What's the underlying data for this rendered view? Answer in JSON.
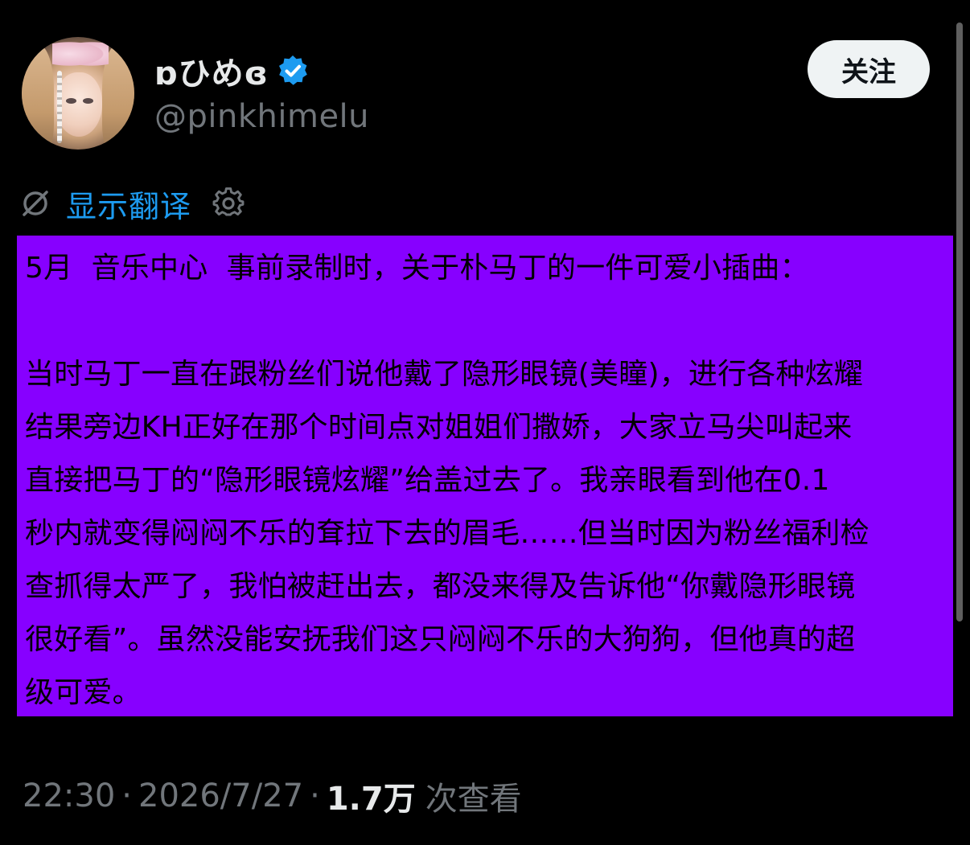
{
  "author": {
    "display_name": "ɒひめɞ",
    "handle": "@pinkhimelu",
    "verified": true,
    "verified_color": "#1d9bf0"
  },
  "actions": {
    "follow_label": "关注"
  },
  "translate": {
    "label": "显示翻译",
    "icons": [
      "translate-off-icon",
      "gear-icon"
    ]
  },
  "tweet": {
    "highlight_color": "#8700ff",
    "lines": [
      "5月  音乐中心  事前录制时，关于朴马丁的一件可爱小插曲：",
      "当时马丁一直在跟粉丝们说他戴了隐形眼镜(美瞳)，进行各种炫耀",
      "结果旁边KH正好在那个时间点对姐姐们撒娇，大家立马尖叫起来",
      "直接把马丁的“隐形眼镜炫耀”给盖过去了。我亲眼看到他在0.1",
      "秒内就变得闷闷不乐的耷拉下去的眉毛……但当时因为粉丝福利检",
      "查抓得太严了，我怕被赶出去，都没来得及告诉他“你戴隐形眼镜",
      "很好看”。虽然没能安抚我们这只闷闷不乐的大狗狗，但他真的超",
      "级可爱。"
    ]
  },
  "meta": {
    "time": "22:30",
    "separator": "·",
    "date": "2026/7/27",
    "views_count": "1.7万",
    "views_label": "次查看"
  }
}
